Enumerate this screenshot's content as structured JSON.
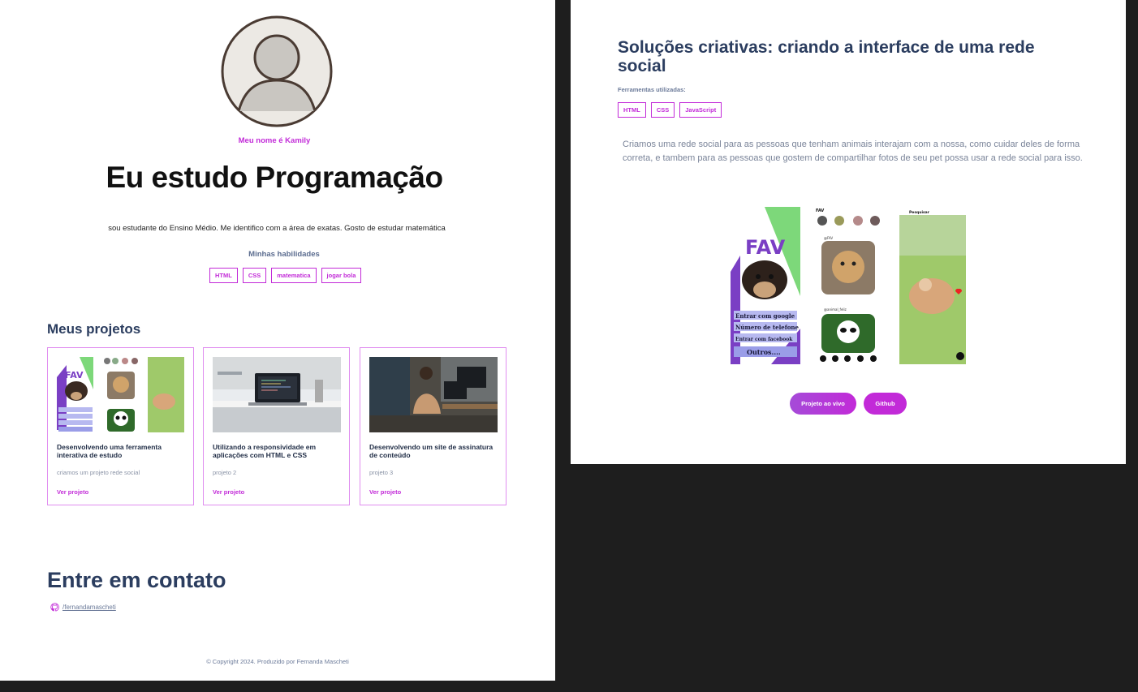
{
  "profile": {
    "name_line": "Meu nome é Kamily",
    "headline": "Eu estudo Programação",
    "bio": "sou estudante do Ensino Médio. Me identifico com a área de exatas. Gosto de estudar matemática",
    "skills_title": "Minhas habilidades",
    "skills": [
      "HTML",
      "CSS",
      "matematica",
      "jogar bola"
    ]
  },
  "projects": {
    "title": "Meus projetos",
    "items": [
      {
        "title": "Desenvolvendo uma ferramenta interativa de estudo",
        "description": "criamos um projeto rede social",
        "link": "Ver projeto"
      },
      {
        "title": "Utilizando a responsividade em aplicações com HTML e CSS",
        "description": "projeto 2",
        "link": "Ver projeto"
      },
      {
        "title": "Desenvolvendo um site de assinatura de conteúdo",
        "description": "projeto 3",
        "link": "Ver projeto"
      }
    ]
  },
  "contact": {
    "title": "Entre em contato",
    "github": "/fernandamascheti",
    "icon": "github-icon"
  },
  "footer": "© Copyright 2024. Produzido por Fernanda Mascheti",
  "detail": {
    "title": "Soluções criativas: criando a interface de uma rede social",
    "tools_label": "Ferramentas utilizadas:",
    "tools": [
      "HTML",
      "CSS",
      "JavaScript"
    ],
    "description": "Criamos uma rede social para as pessoas que tenham animais interajam com a nossa, como cuidar deles de forma correta, e tambem para as pessoas que gostem de compartilhar fotos de seu pet possa usar a rede social para isso.",
    "mockup": {
      "logo": "FAV",
      "login_options": [
        "Entrar com google",
        "Número de telefone",
        "Entrar com facebook",
        "Outros...."
      ],
      "feed_header": "FAV",
      "feed_user": "@FAV",
      "feed_user_2": "@animal_feliz",
      "search_label": "Pesquisar"
    },
    "buttons": {
      "live": "Projeto ao vivo",
      "github": "Github"
    }
  },
  "colors": {
    "accent": "#c22ad8",
    "heading": "#2b3d5f",
    "backdrop": "#1e1e1e"
  }
}
